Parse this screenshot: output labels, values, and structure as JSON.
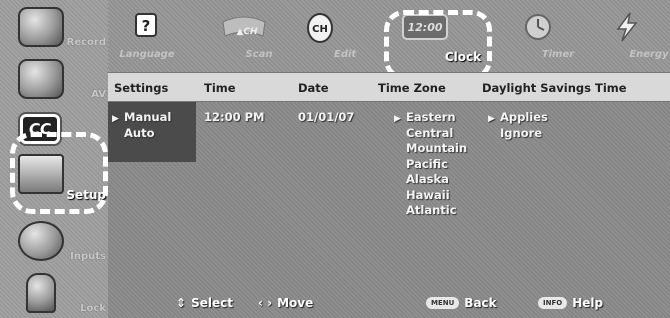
{
  "sidebar": {
    "items": [
      {
        "label": "Record",
        "icon": "record-icon"
      },
      {
        "label": "AV",
        "icon": "av-icon"
      },
      {
        "label": "CC",
        "icon": "cc-icon"
      },
      {
        "label": "Setup",
        "icon": "setup-icon",
        "active": true
      },
      {
        "label": "Inputs",
        "icon": "inputs-icon"
      },
      {
        "label": "Lock",
        "icon": "lock-icon"
      }
    ]
  },
  "tabs": [
    {
      "label": "Language",
      "icon": "language-icon"
    },
    {
      "label": "Scan",
      "icon": "scan-icon"
    },
    {
      "label": "Edit",
      "icon": "ch-edit-icon"
    },
    {
      "label": "Clock",
      "icon": "clock-icon",
      "active": true,
      "face_text": "12:00"
    },
    {
      "label": "Timer",
      "icon": "timer-icon"
    },
    {
      "label": "Energy",
      "icon": "energy-icon"
    }
  ],
  "columns": {
    "settings": "Settings",
    "time": "Time",
    "date": "Date",
    "time_zone": "Time Zone",
    "dst": "Daylight Savings Time"
  },
  "settings_options": [
    "Manual",
    "Auto"
  ],
  "time_value": "12:00 PM",
  "date_value": "01/01/07",
  "time_zones": [
    "Eastern",
    "Central",
    "Mountain",
    "Pacific",
    "Alaska",
    "Hawaii",
    "Atlantic"
  ],
  "dst_options": [
    "Applies",
    "Ignore"
  ],
  "footer": {
    "select": "Select",
    "move": "Move",
    "back_key": "MENU",
    "back": "Back",
    "help_key": "INFO",
    "help": "Help"
  },
  "colors": {
    "background": "#8f8f8f",
    "header": "#d9d9d9",
    "selected_column": "#4b4b4b",
    "highlight": "#ffffff"
  }
}
